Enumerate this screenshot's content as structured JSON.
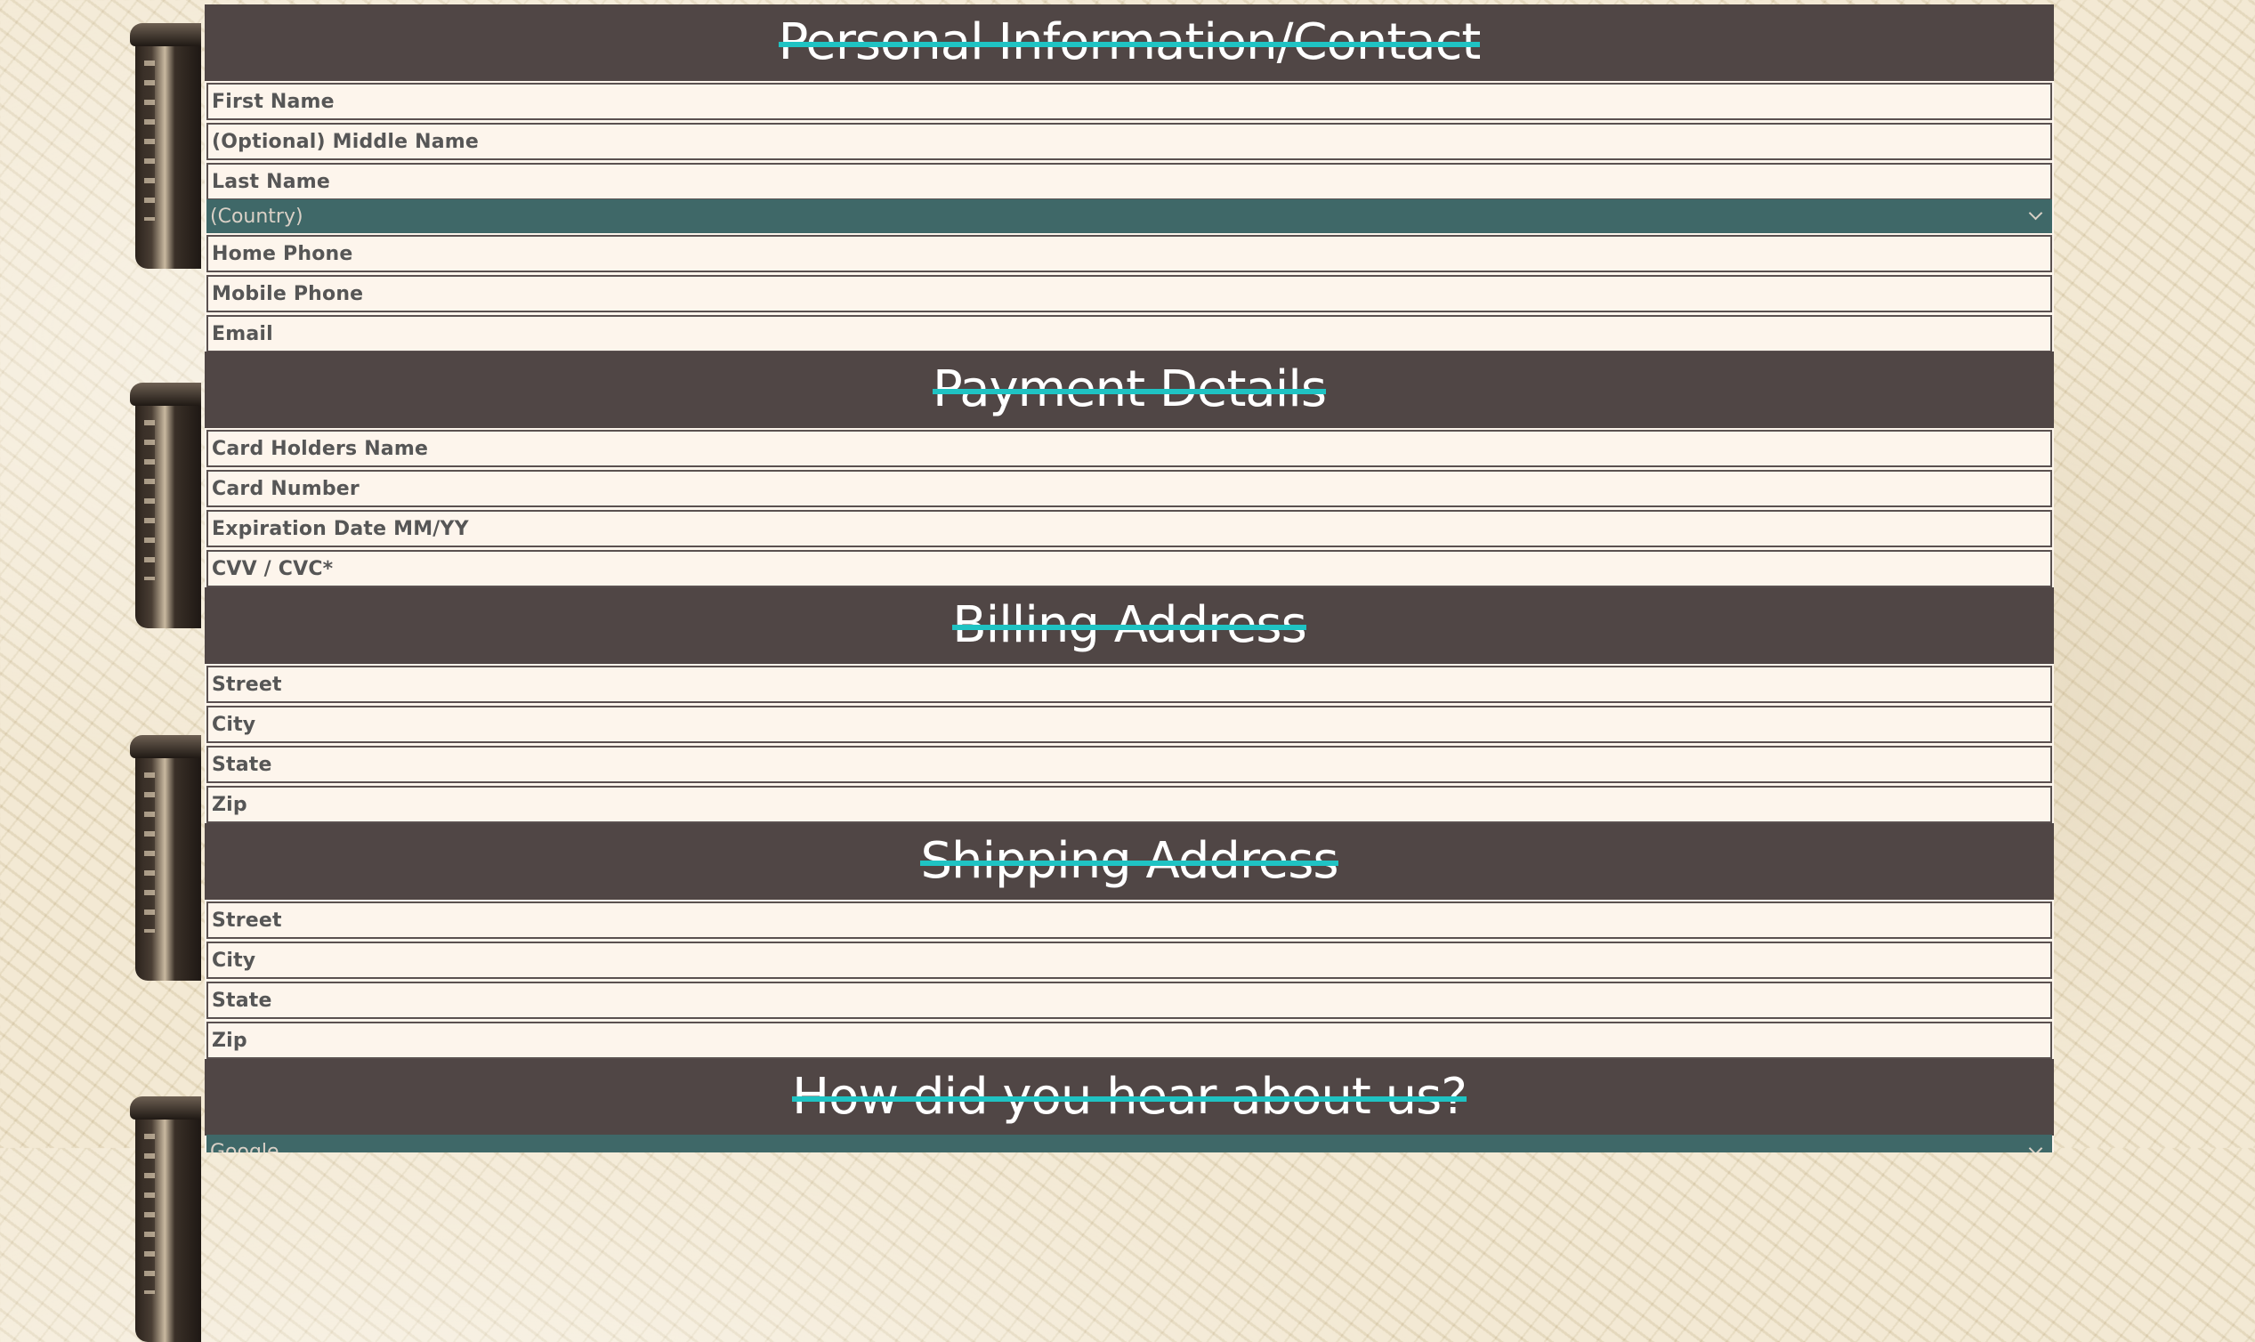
{
  "sections": {
    "personal": {
      "title": "Personal Information/Contact",
      "first_name": "First Name",
      "middle_name": "(Optional) Middle Name",
      "last_name": "Last Name",
      "country": "(Country)",
      "home_phone": "Home Phone",
      "mobile_phone": "Mobile Phone",
      "email": "Email"
    },
    "payment": {
      "title": "Payment Details",
      "card_holder": "Card Holders Name",
      "card_number": "Card Number",
      "expiration": "Expiration Date MM/YY",
      "cvv": "CVV / CVC*"
    },
    "billing": {
      "title": "Billing Address",
      "street": "Street",
      "city": "City",
      "state": "State",
      "zip": "Zip"
    },
    "shipping": {
      "title": "Shipping Address",
      "street": "Street",
      "city": "City",
      "state": "State",
      "zip": "Zip"
    },
    "referral": {
      "title": "How did you hear about us?",
      "selected": "Google"
    }
  },
  "colors": {
    "header_bg": "#504645",
    "strike": "#1fc3c3",
    "select_bg": "#3f6868",
    "field_bg": "#fdf5ec"
  },
  "icons": {
    "select_arrow": "chevron-down-icon",
    "decoration": "trash-can-icon"
  }
}
